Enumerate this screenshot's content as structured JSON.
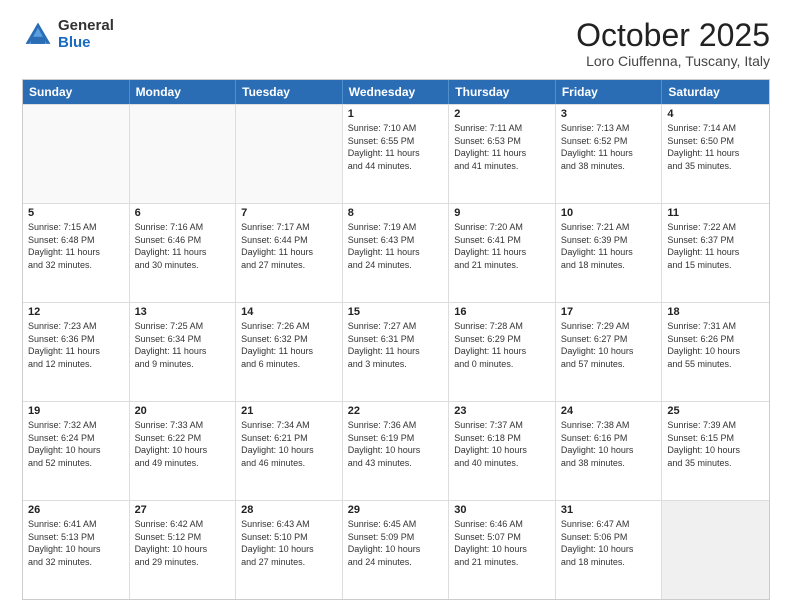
{
  "logo": {
    "general": "General",
    "blue": "Blue"
  },
  "title": "October 2025",
  "location": "Loro Ciuffenna, Tuscany, Italy",
  "days": [
    "Sunday",
    "Monday",
    "Tuesday",
    "Wednesday",
    "Thursday",
    "Friday",
    "Saturday"
  ],
  "weeks": [
    [
      {
        "num": "",
        "detail": ""
      },
      {
        "num": "",
        "detail": ""
      },
      {
        "num": "",
        "detail": ""
      },
      {
        "num": "1",
        "detail": "Sunrise: 7:10 AM\nSunset: 6:55 PM\nDaylight: 11 hours\nand 44 minutes."
      },
      {
        "num": "2",
        "detail": "Sunrise: 7:11 AM\nSunset: 6:53 PM\nDaylight: 11 hours\nand 41 minutes."
      },
      {
        "num": "3",
        "detail": "Sunrise: 7:13 AM\nSunset: 6:52 PM\nDaylight: 11 hours\nand 38 minutes."
      },
      {
        "num": "4",
        "detail": "Sunrise: 7:14 AM\nSunset: 6:50 PM\nDaylight: 11 hours\nand 35 minutes."
      }
    ],
    [
      {
        "num": "5",
        "detail": "Sunrise: 7:15 AM\nSunset: 6:48 PM\nDaylight: 11 hours\nand 32 minutes."
      },
      {
        "num": "6",
        "detail": "Sunrise: 7:16 AM\nSunset: 6:46 PM\nDaylight: 11 hours\nand 30 minutes."
      },
      {
        "num": "7",
        "detail": "Sunrise: 7:17 AM\nSunset: 6:44 PM\nDaylight: 11 hours\nand 27 minutes."
      },
      {
        "num": "8",
        "detail": "Sunrise: 7:19 AM\nSunset: 6:43 PM\nDaylight: 11 hours\nand 24 minutes."
      },
      {
        "num": "9",
        "detail": "Sunrise: 7:20 AM\nSunset: 6:41 PM\nDaylight: 11 hours\nand 21 minutes."
      },
      {
        "num": "10",
        "detail": "Sunrise: 7:21 AM\nSunset: 6:39 PM\nDaylight: 11 hours\nand 18 minutes."
      },
      {
        "num": "11",
        "detail": "Sunrise: 7:22 AM\nSunset: 6:37 PM\nDaylight: 11 hours\nand 15 minutes."
      }
    ],
    [
      {
        "num": "12",
        "detail": "Sunrise: 7:23 AM\nSunset: 6:36 PM\nDaylight: 11 hours\nand 12 minutes."
      },
      {
        "num": "13",
        "detail": "Sunrise: 7:25 AM\nSunset: 6:34 PM\nDaylight: 11 hours\nand 9 minutes."
      },
      {
        "num": "14",
        "detail": "Sunrise: 7:26 AM\nSunset: 6:32 PM\nDaylight: 11 hours\nand 6 minutes."
      },
      {
        "num": "15",
        "detail": "Sunrise: 7:27 AM\nSunset: 6:31 PM\nDaylight: 11 hours\nand 3 minutes."
      },
      {
        "num": "16",
        "detail": "Sunrise: 7:28 AM\nSunset: 6:29 PM\nDaylight: 11 hours\nand 0 minutes."
      },
      {
        "num": "17",
        "detail": "Sunrise: 7:29 AM\nSunset: 6:27 PM\nDaylight: 10 hours\nand 57 minutes."
      },
      {
        "num": "18",
        "detail": "Sunrise: 7:31 AM\nSunset: 6:26 PM\nDaylight: 10 hours\nand 55 minutes."
      }
    ],
    [
      {
        "num": "19",
        "detail": "Sunrise: 7:32 AM\nSunset: 6:24 PM\nDaylight: 10 hours\nand 52 minutes."
      },
      {
        "num": "20",
        "detail": "Sunrise: 7:33 AM\nSunset: 6:22 PM\nDaylight: 10 hours\nand 49 minutes."
      },
      {
        "num": "21",
        "detail": "Sunrise: 7:34 AM\nSunset: 6:21 PM\nDaylight: 10 hours\nand 46 minutes."
      },
      {
        "num": "22",
        "detail": "Sunrise: 7:36 AM\nSunset: 6:19 PM\nDaylight: 10 hours\nand 43 minutes."
      },
      {
        "num": "23",
        "detail": "Sunrise: 7:37 AM\nSunset: 6:18 PM\nDaylight: 10 hours\nand 40 minutes."
      },
      {
        "num": "24",
        "detail": "Sunrise: 7:38 AM\nSunset: 6:16 PM\nDaylight: 10 hours\nand 38 minutes."
      },
      {
        "num": "25",
        "detail": "Sunrise: 7:39 AM\nSunset: 6:15 PM\nDaylight: 10 hours\nand 35 minutes."
      }
    ],
    [
      {
        "num": "26",
        "detail": "Sunrise: 6:41 AM\nSunset: 5:13 PM\nDaylight: 10 hours\nand 32 minutes."
      },
      {
        "num": "27",
        "detail": "Sunrise: 6:42 AM\nSunset: 5:12 PM\nDaylight: 10 hours\nand 29 minutes."
      },
      {
        "num": "28",
        "detail": "Sunrise: 6:43 AM\nSunset: 5:10 PM\nDaylight: 10 hours\nand 27 minutes."
      },
      {
        "num": "29",
        "detail": "Sunrise: 6:45 AM\nSunset: 5:09 PM\nDaylight: 10 hours\nand 24 minutes."
      },
      {
        "num": "30",
        "detail": "Sunrise: 6:46 AM\nSunset: 5:07 PM\nDaylight: 10 hours\nand 21 minutes."
      },
      {
        "num": "31",
        "detail": "Sunrise: 6:47 AM\nSunset: 5:06 PM\nDaylight: 10 hours\nand 18 minutes."
      },
      {
        "num": "",
        "detail": ""
      }
    ]
  ]
}
